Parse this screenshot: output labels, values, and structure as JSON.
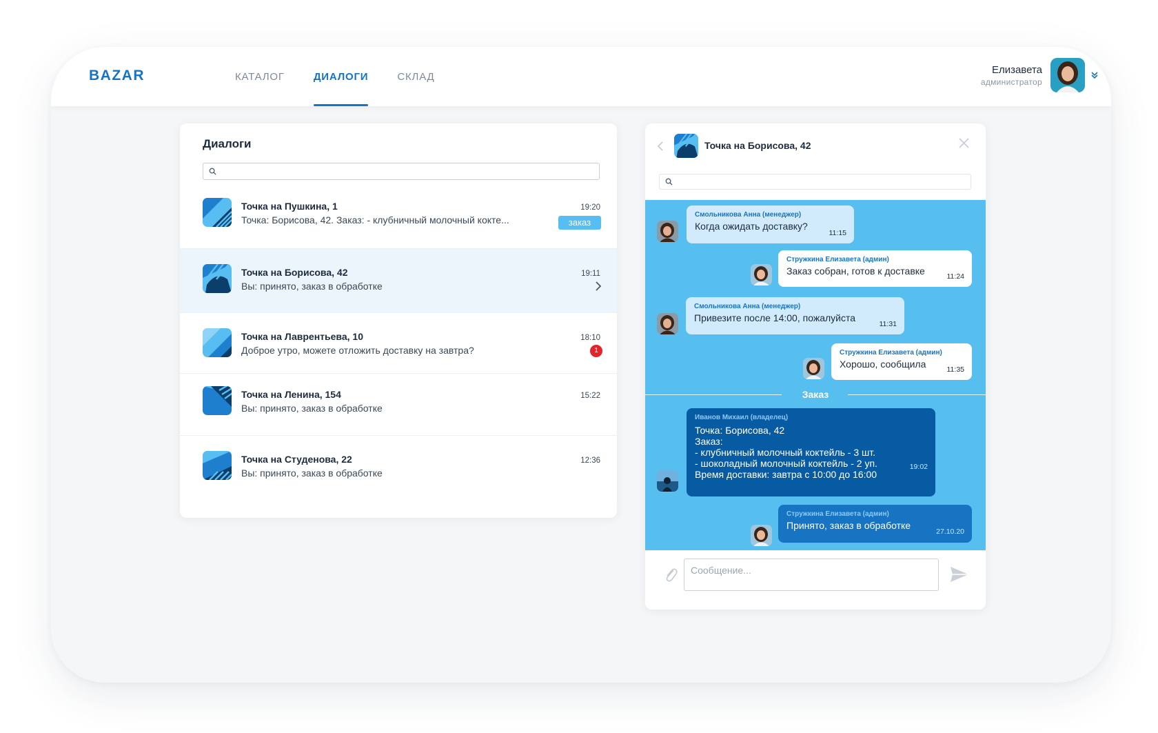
{
  "app": {
    "logo": "BAZAR",
    "nav": [
      {
        "label": "КАТАЛОГ",
        "active": false
      },
      {
        "label": "ДИАЛОГИ",
        "active": true
      },
      {
        "label": "СКЛАД",
        "active": false
      }
    ],
    "user": {
      "name": "Елизавета",
      "role": "администратор"
    }
  },
  "dialogs": {
    "title": "Диалоги",
    "search_placeholder": "",
    "items": [
      {
        "name": "Точка на Пушкина, 1",
        "preview": "Точка: Борисова, 42. Заказ:  - клубничный молочный кокте...",
        "time": "19:20",
        "badge": "заказ"
      },
      {
        "name": "Точка на Борисова, 42",
        "preview": "Вы: принято, заказ в обработке",
        "time": "19:11"
      },
      {
        "name": "Точка на Лаврентьева, 10",
        "preview": "Доброе утро, можете отложить доставку на завтра?",
        "time": "18:10",
        "unread": "1"
      },
      {
        "name": "Точка на Ленина, 154",
        "preview": "Вы: принято, заказ в обработке",
        "time": "15:22"
      },
      {
        "name": "Точка на Студенова, 22",
        "preview": "Вы: принято, заказ в обработке",
        "time": "12:36"
      }
    ]
  },
  "chat": {
    "title": "Точка на Борисова, 42",
    "search_placeholder": "",
    "messages": [
      {
        "author": "Смольникова Анна (менеджер)",
        "text": "Когда ожидать доставку?",
        "time": "11:15"
      },
      {
        "author": "Стружкина Елизавета (админ)",
        "text": "Заказ собран, готов к доставке",
        "time": "11:24"
      },
      {
        "author": "Смольникова Анна (менеджер)",
        "text": "Привезите после 14:00, пожалуйста",
        "time": "11:31"
      },
      {
        "author": "Стружкина Елизавета (админ)",
        "text": "Хорошо, сообщила",
        "time": "11:35"
      },
      {
        "author": "Иванов Михаил (владелец)",
        "text": "Точка: Борисова, 42\nЗаказ:\n- клубничный молочный коктейль - 3 шт.\n- шоколадный молочный коктейль - 2 уп.\nВремя доставки: завтра с 10:00 до 16:00",
        "time": "19:02"
      },
      {
        "author": "Стружкина Елизавета (админ)",
        "text": "Принято, заказ в обработке",
        "time": "27.10.20"
      }
    ],
    "divider": "Заказ",
    "composer_placeholder": "Сообщение..."
  },
  "colors": {
    "accent": "#1674c3",
    "chat_bg": "#57bff0",
    "unread": "#e3242b",
    "badge": "#58bdf0"
  },
  "icons": [
    "search-icon",
    "chevron-right-icon",
    "chevron-left-icon",
    "close-icon",
    "paperclip-icon",
    "send-icon",
    "double-chevron-down-icon"
  ]
}
